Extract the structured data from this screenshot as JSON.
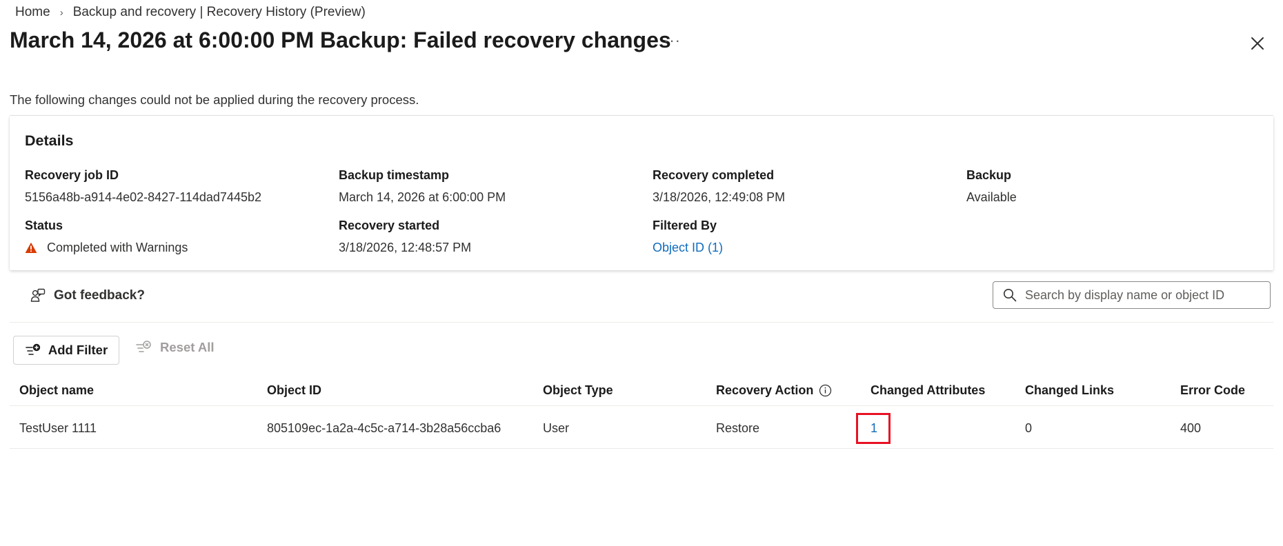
{
  "breadcrumb": {
    "home": "Home",
    "separator": "›",
    "current": "Backup and recovery | Recovery History (Preview)"
  },
  "header": {
    "title": "March 14, 2026 at 6:00:00 PM Backup: Failed recovery changes",
    "more_label": "···"
  },
  "description": "The following changes could not be applied during the recovery process.",
  "details": {
    "heading": "Details",
    "recovery_job_id": {
      "label": "Recovery job ID",
      "value": "5156a48b-a914-4e02-8427-114dad7445b2"
    },
    "backup_timestamp": {
      "label": "Backup timestamp",
      "value": "March 14, 2026 at 6:00:00 PM"
    },
    "recovery_completed": {
      "label": "Recovery completed",
      "value": "3/18/2026, 12:49:08 PM"
    },
    "backup": {
      "label": "Backup",
      "value": "Available"
    },
    "status": {
      "label": "Status",
      "value": "Completed with Warnings",
      "icon": "warning-icon",
      "icon_color": "#d83b01"
    },
    "recovery_started": {
      "label": "Recovery started",
      "value": "3/18/2026, 12:48:57 PM"
    },
    "filtered_by": {
      "label": "Filtered By",
      "value": "Object ID (1)"
    }
  },
  "toolbar": {
    "feedback_label": "Got feedback?",
    "search_placeholder": "Search by display name or object ID",
    "add_filter_label": "Add Filter",
    "reset_all_label": "Reset All"
  },
  "table": {
    "columns": [
      "Object name",
      "Object ID",
      "Object Type",
      "Recovery Action",
      "Changed Attributes",
      "Changed Links",
      "Error Code"
    ],
    "rows": [
      {
        "object_name": "TestUser 1111",
        "object_id": "805109ec-1a2a-4c5c-a714-3b28a56ccba6",
        "object_type": "User",
        "recovery_action": "Restore",
        "changed_attributes": "1",
        "changed_links": "0",
        "error_code": "400"
      }
    ]
  },
  "colors": {
    "link": "#0f6cbd",
    "highlight": "#e81123",
    "warning": "#d83b01"
  }
}
